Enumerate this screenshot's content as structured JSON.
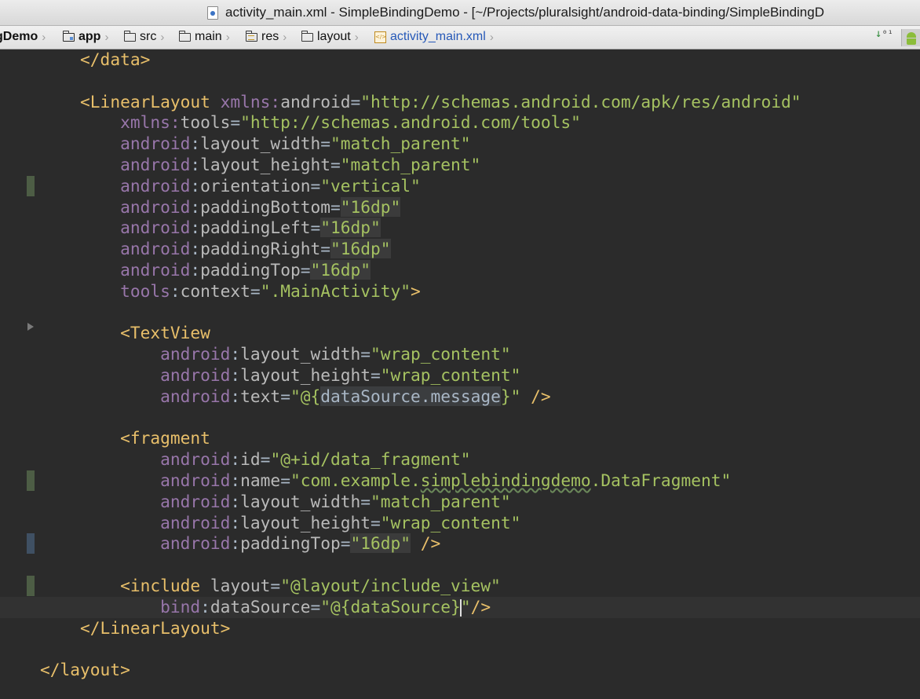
{
  "window": {
    "title": "activity_main.xml - SimpleBindingDemo - [~/Projects/pluralsight/android-data-binding/SimpleBindingD"
  },
  "breadcrumbs": [
    {
      "label": "gDemo",
      "icon": null
    },
    {
      "label": "app",
      "icon": "app-module-icon"
    },
    {
      "label": "src",
      "icon": "folder-icon"
    },
    {
      "label": "main",
      "icon": "folder-icon"
    },
    {
      "label": "res",
      "icon": "resources-folder-icon"
    },
    {
      "label": "layout",
      "icon": "folder-icon"
    },
    {
      "label": "activity_main.xml",
      "icon": "xml-file-icon"
    }
  ],
  "toolbar": {
    "sort_icon": "sort-icon",
    "android_icon": "android-icon"
  },
  "editor": {
    "current_line": 26,
    "lines": [
      [
        [
          "tag",
          "        </data>"
        ]
      ],
      [],
      [
        [
          "tag",
          "        <LinearLayout "
        ],
        [
          "ns",
          "xmlns:"
        ],
        [
          "attr",
          "android"
        ],
        [
          "plain",
          "="
        ],
        [
          "val",
          "\"http://schemas.android.com/apk/res/android\""
        ]
      ],
      [
        [
          "ns",
          "            xmlns:"
        ],
        [
          "attr",
          "tools"
        ],
        [
          "plain",
          "="
        ],
        [
          "val",
          "\"http://schemas.android.com/tools\""
        ]
      ],
      [
        [
          "ns",
          "            android"
        ],
        [
          "plain",
          ":"
        ],
        [
          "attr",
          "layout_width"
        ],
        [
          "plain",
          "="
        ],
        [
          "val",
          "\"match_parent\""
        ]
      ],
      [
        [
          "ns",
          "            android"
        ],
        [
          "plain",
          ":"
        ],
        [
          "attr",
          "layout_height"
        ],
        [
          "plain",
          "="
        ],
        [
          "val",
          "\"match_parent\""
        ]
      ],
      [
        [
          "ns",
          "            android"
        ],
        [
          "plain",
          ":"
        ],
        [
          "attr",
          "orientation"
        ],
        [
          "plain",
          "="
        ],
        [
          "val",
          "\"vertical\""
        ]
      ],
      [
        [
          "ns",
          "            android"
        ],
        [
          "plain",
          ":"
        ],
        [
          "attr",
          "paddingBottom"
        ],
        [
          "plain",
          "="
        ],
        [
          "val hl",
          "\"16dp\""
        ]
      ],
      [
        [
          "ns",
          "            android"
        ],
        [
          "plain",
          ":"
        ],
        [
          "attr",
          "paddingLeft"
        ],
        [
          "plain",
          "="
        ],
        [
          "val hl",
          "\"16dp\""
        ]
      ],
      [
        [
          "ns",
          "            android"
        ],
        [
          "plain",
          ":"
        ],
        [
          "attr",
          "paddingRight"
        ],
        [
          "plain",
          "="
        ],
        [
          "val hl",
          "\"16dp\""
        ]
      ],
      [
        [
          "ns",
          "            android"
        ],
        [
          "plain",
          ":"
        ],
        [
          "attr",
          "paddingTop"
        ],
        [
          "plain",
          "="
        ],
        [
          "val hl",
          "\"16dp\""
        ]
      ],
      [
        [
          "ns",
          "            tools"
        ],
        [
          "plain",
          ":"
        ],
        [
          "attr",
          "context"
        ],
        [
          "plain",
          "="
        ],
        [
          "val",
          "\".MainActivity\""
        ],
        [
          "tag",
          ">"
        ]
      ],
      [],
      [
        [
          "tag",
          "            <TextView"
        ]
      ],
      [
        [
          "ns",
          "                android"
        ],
        [
          "plain",
          ":"
        ],
        [
          "attr",
          "layout_width"
        ],
        [
          "plain",
          "="
        ],
        [
          "val",
          "\"wrap_content\""
        ]
      ],
      [
        [
          "ns",
          "                android"
        ],
        [
          "plain",
          ":"
        ],
        [
          "attr",
          "layout_height"
        ],
        [
          "plain",
          "="
        ],
        [
          "val",
          "\"wrap_content\""
        ]
      ],
      [
        [
          "ns",
          "                android"
        ],
        [
          "plain",
          ":"
        ],
        [
          "attr",
          "text"
        ],
        [
          "plain",
          "="
        ],
        [
          "val",
          "\"@{"
        ],
        [
          "ident",
          "dataSource.message"
        ],
        [
          "val",
          "}\""
        ],
        [
          "tag",
          " />"
        ]
      ],
      [],
      [
        [
          "tag",
          "            <fragment"
        ]
      ],
      [
        [
          "ns",
          "                android"
        ],
        [
          "plain",
          ":"
        ],
        [
          "attr",
          "id"
        ],
        [
          "plain",
          "="
        ],
        [
          "val",
          "\"@+id/data_fragment\""
        ]
      ],
      [
        [
          "ns",
          "                android"
        ],
        [
          "plain",
          ":"
        ],
        [
          "attr",
          "name"
        ],
        [
          "plain",
          "="
        ],
        [
          "val",
          "\"com.example."
        ],
        [
          "val typo",
          "simplebindingdemo"
        ],
        [
          "val",
          ".DataFragment\""
        ]
      ],
      [
        [
          "ns",
          "                android"
        ],
        [
          "plain",
          ":"
        ],
        [
          "attr",
          "layout_width"
        ],
        [
          "plain",
          "="
        ],
        [
          "val",
          "\"match_parent\""
        ]
      ],
      [
        [
          "ns",
          "                android"
        ],
        [
          "plain",
          ":"
        ],
        [
          "attr",
          "layout_height"
        ],
        [
          "plain",
          "="
        ],
        [
          "val",
          "\"wrap_content\""
        ]
      ],
      [
        [
          "ns",
          "                android"
        ],
        [
          "plain",
          ":"
        ],
        [
          "attr",
          "paddingTop"
        ],
        [
          "plain",
          "="
        ],
        [
          "val hl",
          "\"16dp\""
        ],
        [
          "tag",
          " />"
        ]
      ],
      [],
      [
        [
          "tag",
          "            <include "
        ],
        [
          "attr",
          "layout"
        ],
        [
          "plain",
          "="
        ],
        [
          "val",
          "\"@layout/include_view\""
        ]
      ],
      [
        [
          "ns",
          "                bind"
        ],
        [
          "plain",
          ":"
        ],
        [
          "attr",
          "dataSource"
        ],
        [
          "plain",
          "="
        ],
        [
          "val",
          "\"@{dataSource}"
        ],
        [
          "caret",
          ""
        ],
        [
          "val",
          "\""
        ],
        [
          "tag",
          "/>"
        ]
      ],
      [
        [
          "tag",
          "        </LinearLayout>"
        ]
      ],
      [],
      [
        [
          "tag",
          "    </layout>"
        ]
      ]
    ],
    "gutter_markers": [
      {
        "line": 6,
        "kind": "mod"
      },
      {
        "line": 20,
        "kind": "mod"
      },
      {
        "line": 23,
        "kind": "blue"
      },
      {
        "line": 25,
        "kind": "mod"
      },
      {
        "line": 26,
        "kind": "mod"
      }
    ]
  }
}
